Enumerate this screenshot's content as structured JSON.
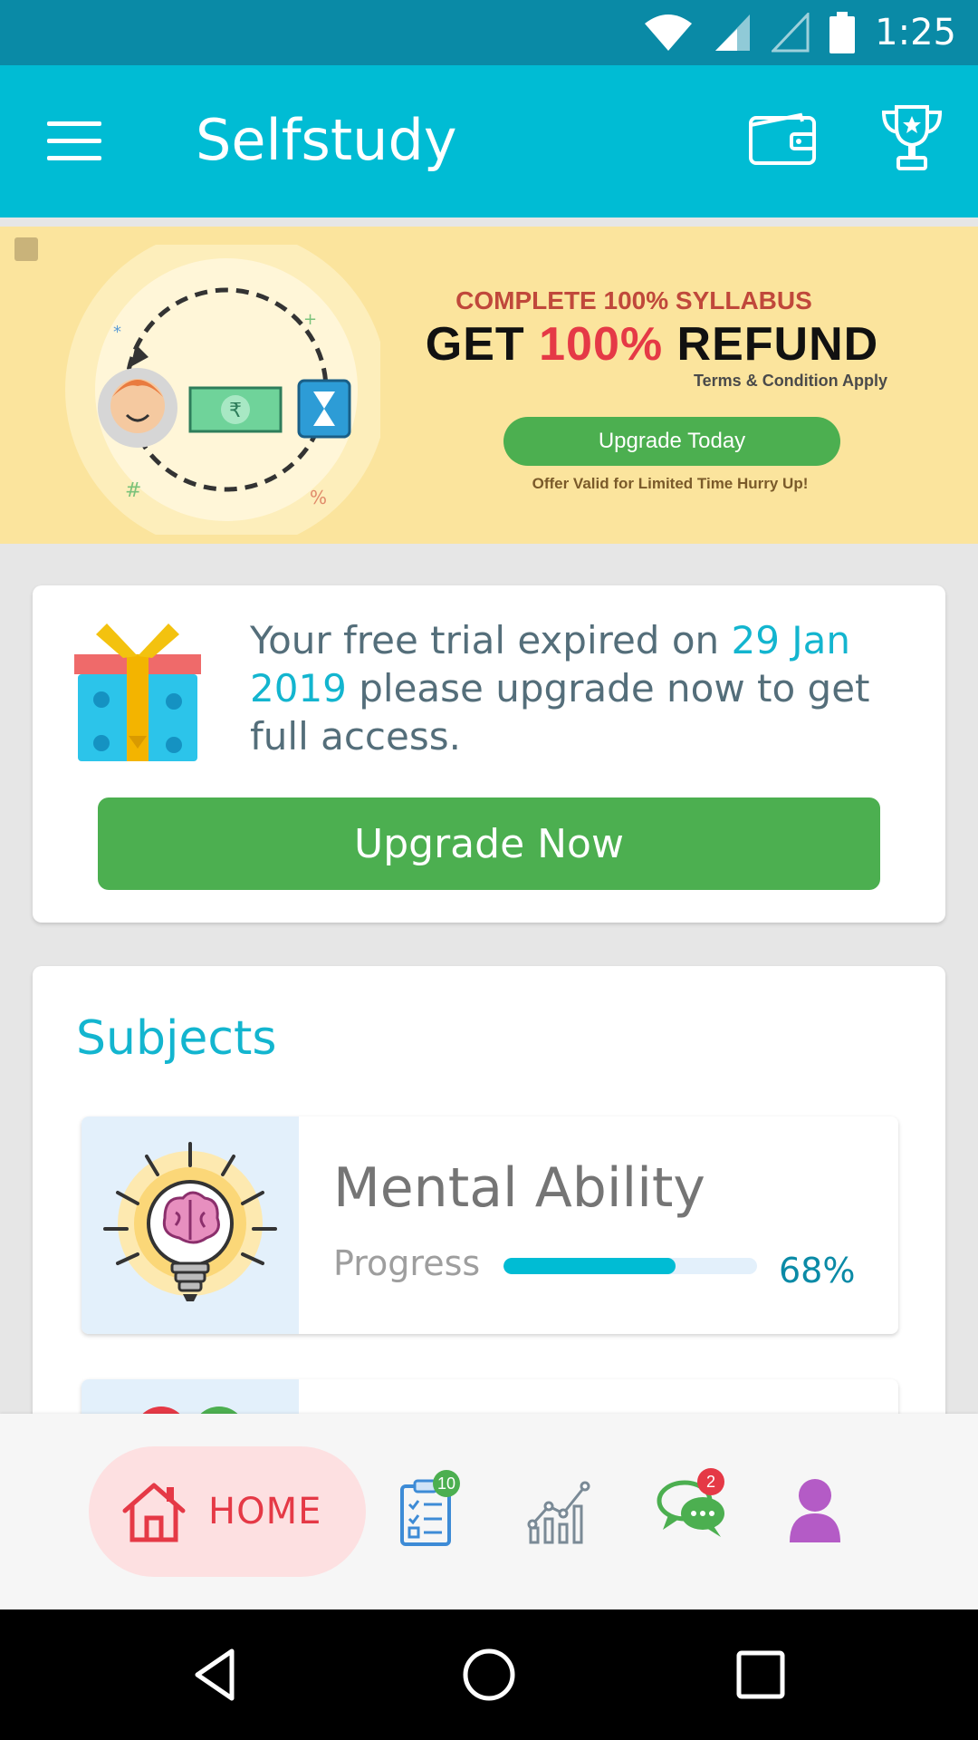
{
  "status_bar": {
    "time": "1:25"
  },
  "app_bar": {
    "title": "Selfstudy"
  },
  "promo": {
    "headline_line1": "COMPLETE 100% SYLLABUS",
    "headline_get": "GET ",
    "headline_accent": "100%",
    "headline_refund": " REFUND",
    "terms": "Terms & Condition Apply",
    "cta_label": "Upgrade Today",
    "offer_note": "Offer Valid for Limited Time Hurry Up!",
    "rupee_symbol": "₹"
  },
  "trial_card": {
    "message_before": "Your free trial expired on ",
    "expiry_date": "29 Jan 2019",
    "message_after": " please upgrade now to get full access.",
    "button_label": "Upgrade Now"
  },
  "subjects": {
    "title": "Subjects",
    "items": [
      {
        "name": "Mental Ability",
        "progress_label": "Progress",
        "progress_value": "68%",
        "progress_fraction": 0.68,
        "icon": "brain-bulb-icon"
      }
    ]
  },
  "bottom_nav": {
    "home_label": "HOME",
    "tests_badge": "10",
    "chat_badge": "2",
    "items": [
      "home-icon",
      "tests-clipboard-icon",
      "stats-chart-icon",
      "chat-bubbles-icon",
      "profile-icon"
    ]
  },
  "colors": {
    "primary": "#00bcd4",
    "status_bar": "#0a8aa6",
    "green": "#4caf50",
    "home_accent": "#e53946",
    "banner_bg": "#fbe49d"
  }
}
